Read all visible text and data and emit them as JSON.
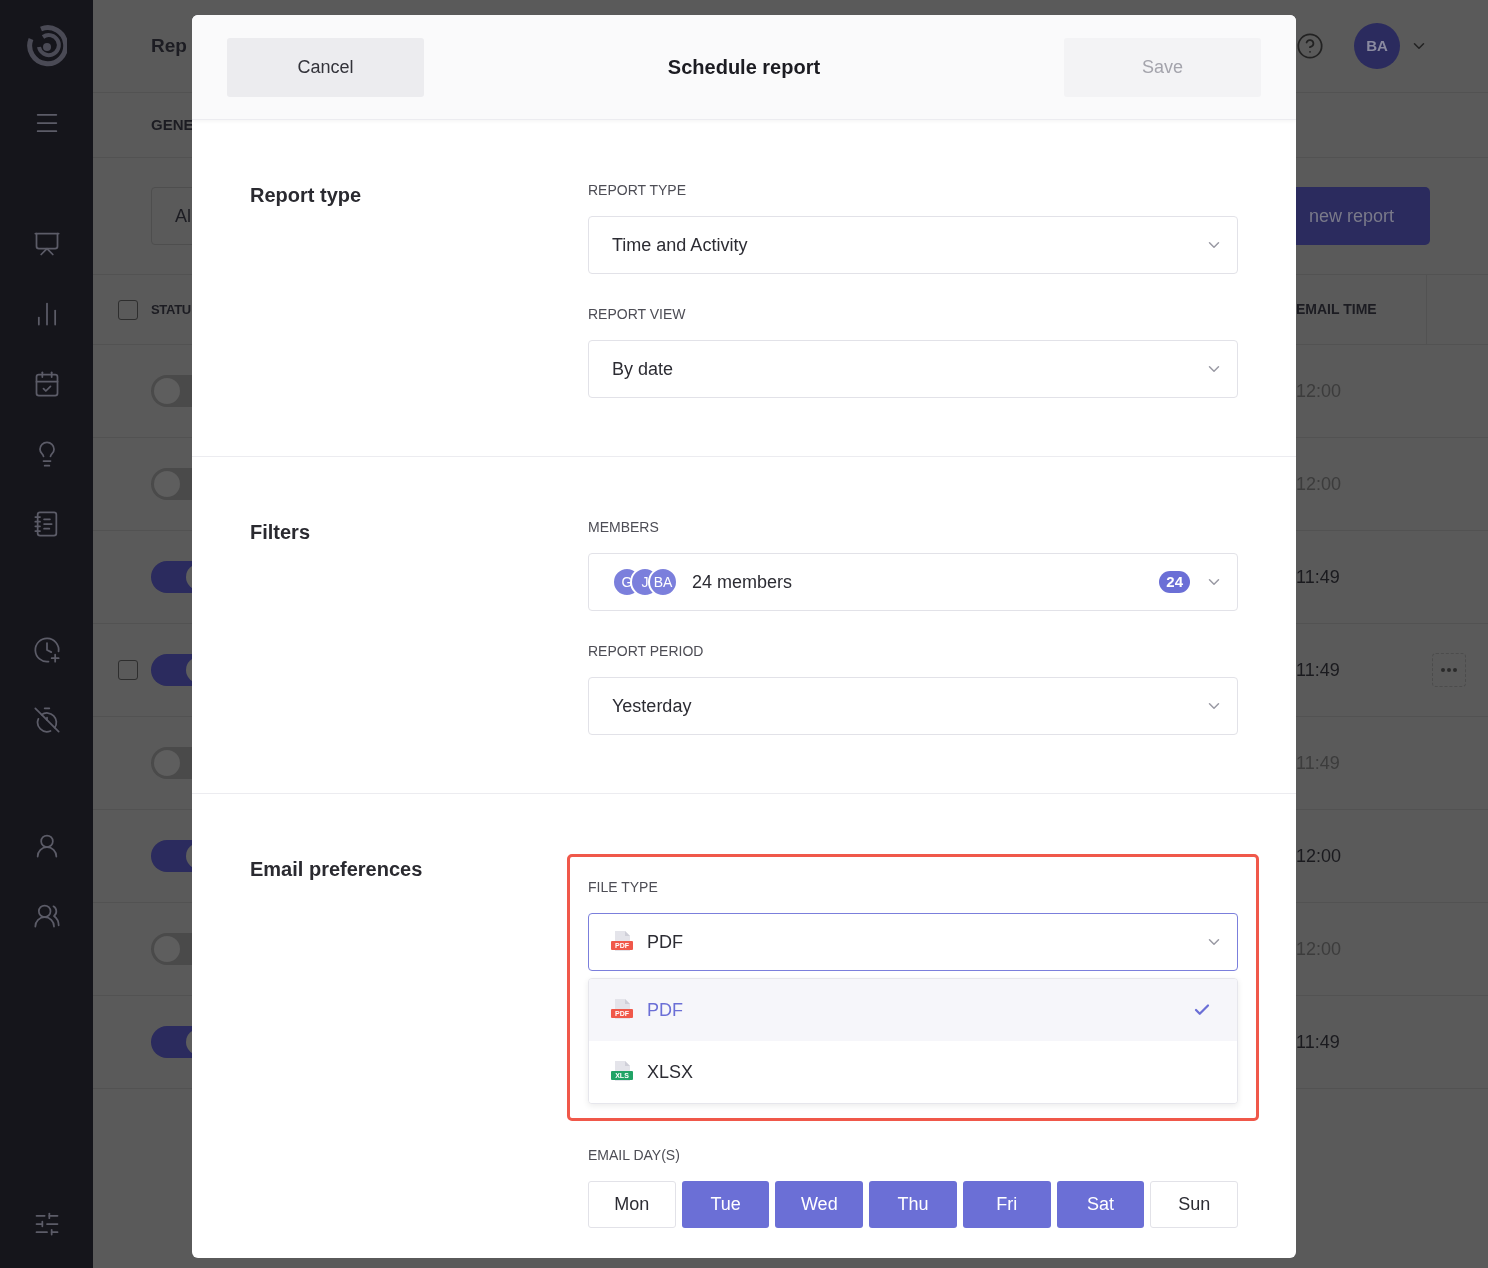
{
  "app": {
    "page_title": "Rep",
    "tab": "GENE",
    "filter_value": "Al",
    "new_report_button": "new report",
    "user_initials": "BA"
  },
  "table": {
    "columns": [
      "STATU",
      "EMAIL TIME"
    ],
    "select_all_checked": false,
    "rows": [
      {
        "on": false,
        "email_time": "12:00",
        "hovered": false
      },
      {
        "on": false,
        "email_time": "12:00",
        "hovered": false
      },
      {
        "on": true,
        "email_time": "11:49",
        "hovered": false
      },
      {
        "on": true,
        "email_time": "11:49",
        "hovered": true,
        "checkbox": {
          "checked": false
        }
      },
      {
        "on": false,
        "email_time": "11:49",
        "hovered": false
      },
      {
        "on": true,
        "email_time": "12:00",
        "hovered": false
      },
      {
        "on": false,
        "email_time": "12:00",
        "hovered": false
      },
      {
        "on": true,
        "email_time": "11:49",
        "hovered": false
      }
    ]
  },
  "dialog": {
    "title": "Schedule report",
    "cancel_button": "Cancel",
    "save_button": {
      "label": "Save",
      "disabled": true
    },
    "sections": [
      {
        "title": "Report type",
        "fields": [
          {
            "kind": "select",
            "label": "REPORT TYPE",
            "value": "Time and Activity"
          },
          {
            "kind": "select",
            "label": "REPORT VIEW",
            "value": "By date"
          }
        ]
      },
      {
        "title": "Filters",
        "fields": [
          {
            "kind": "members",
            "label": "MEMBERS",
            "value": "24 members",
            "avatars": [
              "G",
              "J",
              "BA"
            ],
            "count": "24"
          },
          {
            "kind": "select",
            "label": "REPORT PERIOD",
            "value": "Yesterday"
          }
        ]
      },
      {
        "title": "Email preferences",
        "fields": [
          {
            "kind": "filetype",
            "label": "FILE TYPE",
            "value": "PDF",
            "icon_text": "PDF",
            "color": "#f0584a",
            "highlighted": true,
            "expanded": true,
            "options": [
              {
                "label": "PDF",
                "icon_text": "PDF",
                "color": "#f0584a",
                "selected": true
              },
              {
                "label": "XLSX",
                "icon_text": "XLS",
                "color": "#21a366",
                "selected": false
              }
            ]
          },
          {
            "kind": "days",
            "label": "EMAIL DAY(S)",
            "days": [
              {
                "label": "Mon",
                "selected": false
              },
              {
                "label": "Tue",
                "selected": true
              },
              {
                "label": "Wed",
                "selected": true
              },
              {
                "label": "Thu",
                "selected": true
              },
              {
                "label": "Fri",
                "selected": true
              },
              {
                "label": "Sat",
                "selected": true
              },
              {
                "label": "Sun",
                "selected": false
              }
            ]
          }
        ]
      }
    ]
  }
}
